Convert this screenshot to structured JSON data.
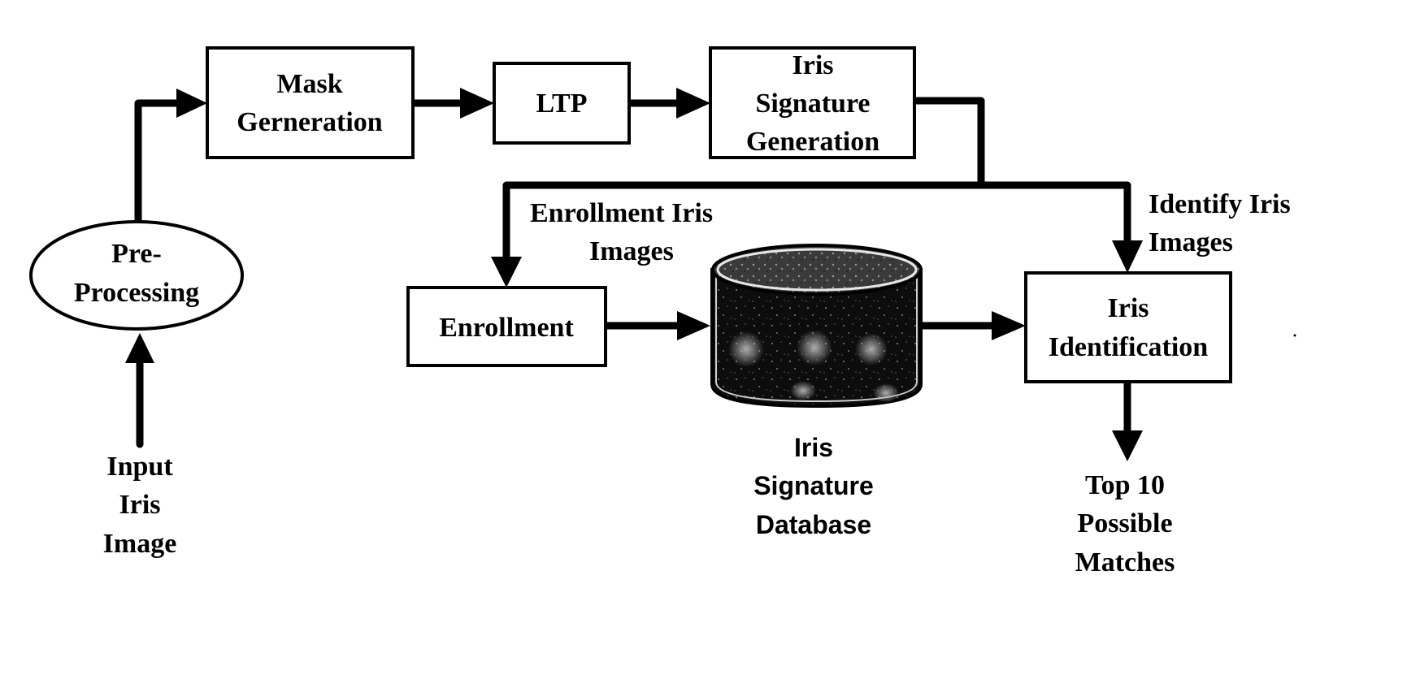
{
  "colors": {
    "stroke": "#000000",
    "background": "#ffffff",
    "database_fill": "#111111",
    "database_highlight": "#9a9a9a"
  },
  "nodes": {
    "input": {
      "label_lines": [
        "Input",
        "Iris",
        "Image"
      ]
    },
    "preprocessing": {
      "label_lines": [
        "Pre-",
        "Processing"
      ]
    },
    "mask_generation": {
      "label_lines": [
        "Mask",
        "Gerneration"
      ]
    },
    "ltp": {
      "label_lines": [
        "LTP"
      ]
    },
    "signature_generation": {
      "label_lines": [
        "Iris",
        "Signature",
        "Generation"
      ]
    },
    "enrollment": {
      "label_lines": [
        "Enrollment"
      ]
    },
    "database": {
      "label_lines": [
        "Iris",
        "Signature",
        "Database"
      ]
    },
    "identification": {
      "label_lines": [
        "Iris",
        "Identification"
      ]
    },
    "output": {
      "label_lines": [
        "Top 10",
        "Possible",
        "Matches"
      ]
    }
  },
  "edge_labels": {
    "enrollment_branch": [
      "Enrollment Iris",
      "Images"
    ],
    "identify_branch": [
      "Identify Iris",
      "Images"
    ]
  },
  "edges": [
    {
      "from": "input",
      "to": "preprocessing"
    },
    {
      "from": "preprocessing",
      "to": "mask_generation"
    },
    {
      "from": "mask_generation",
      "to": "ltp"
    },
    {
      "from": "ltp",
      "to": "signature_generation"
    },
    {
      "from": "signature_generation",
      "to": "enrollment",
      "label": "enrollment_branch"
    },
    {
      "from": "signature_generation",
      "to": "identification",
      "label": "identify_branch"
    },
    {
      "from": "enrollment",
      "to": "database"
    },
    {
      "from": "database",
      "to": "identification"
    },
    {
      "from": "identification",
      "to": "output"
    }
  ]
}
